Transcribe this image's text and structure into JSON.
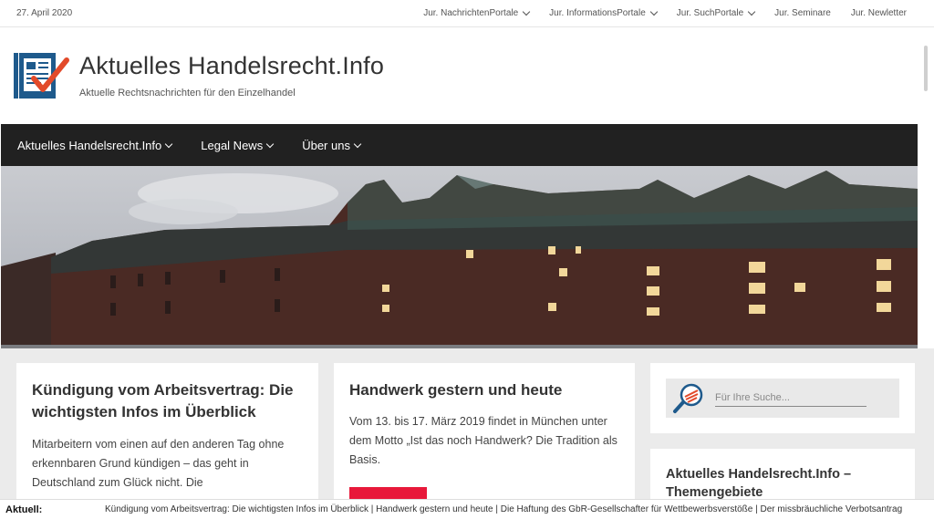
{
  "topbar": {
    "date": "27. April 2020",
    "nav": [
      {
        "label": "Jur. NachrichtenPortale",
        "dropdown": true
      },
      {
        "label": "Jur. InformationsPortale",
        "dropdown": true
      },
      {
        "label": "Jur. SuchPortale",
        "dropdown": true
      },
      {
        "label": "Jur. Seminare",
        "dropdown": false
      },
      {
        "label": "Jur. Newletter",
        "dropdown": false
      }
    ]
  },
  "header": {
    "site_title": "Aktuelles Handelsrecht.Info",
    "site_description": "Aktuelle Rechtsnachrichten für den Einzelhandel"
  },
  "main_nav": [
    {
      "label": "Aktuelles Handelsrecht.Info"
    },
    {
      "label": "Legal News"
    },
    {
      "label": "Über uns"
    }
  ],
  "posts": [
    {
      "title": "Kündigung vom Arbeitsvertrag: Die wichtigsten Infos im Überblick",
      "excerpt": "Mitarbeitern vom einen auf den anderen Tag ohne erkennbaren Grund kündigen – das geht in Deutschland zum Glück nicht. Die"
    },
    {
      "title": "Handwerk gestern und heute",
      "excerpt": "Vom 13. bis 17. März 2019 findet in München unter dem Motto „Ist das noch Handwerk? Die Tradition als Basis."
    }
  ],
  "sidebar": {
    "search_placeholder": "Für Ihre Suche...",
    "widget_title": "Aktuelles Handelsrecht.Info – Themengebiete"
  },
  "ticker": {
    "label": "Aktuell:",
    "text": "Kündigung vom Arbeitsvertrag: Die wichtigsten Infos im Überblick | Handwerk gestern und heute | Die Haftung des GbR-Gesellschafter für Wettbewerbsverstöße | Der missbräuchliche Verbotsantrag"
  },
  "colors": {
    "nav_background": "#212121",
    "accent_red": "#e8183a",
    "logo_blue": "#1e5a8c",
    "content_background": "#ebebeb"
  }
}
